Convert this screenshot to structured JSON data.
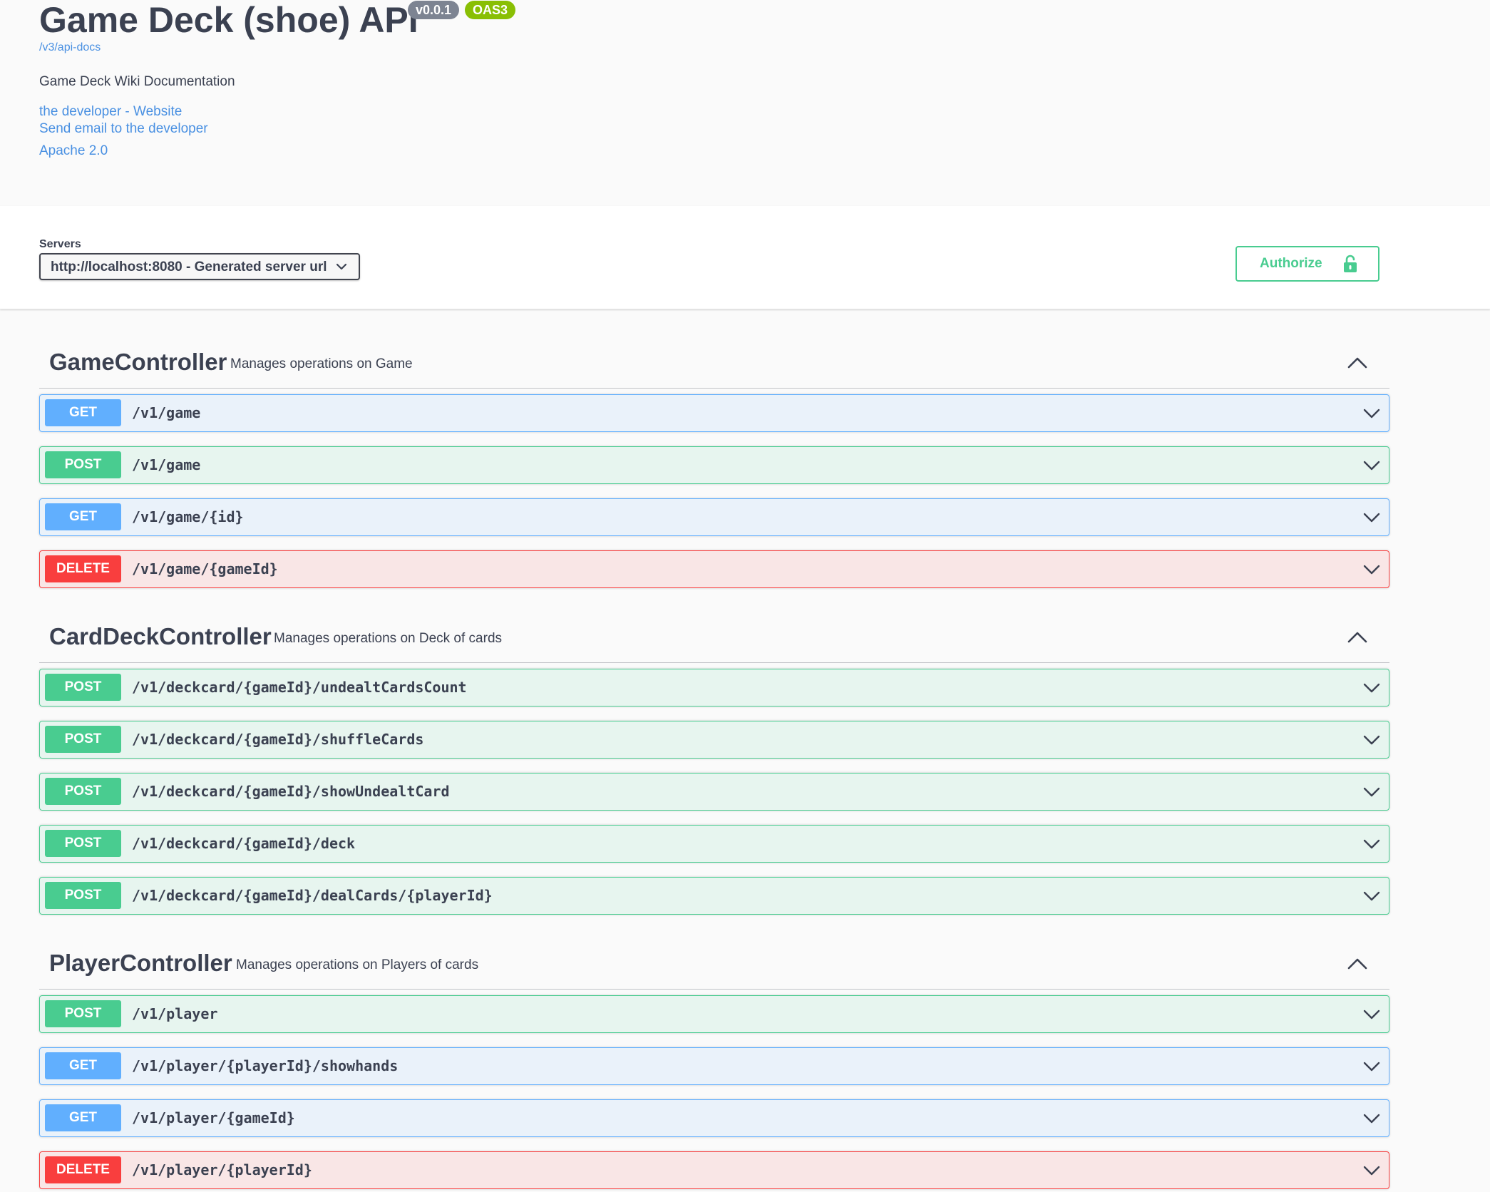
{
  "info": {
    "title": "Game Deck (shoe) API",
    "version": "v0.0.1",
    "oas": "OAS3",
    "spec_link": "/v3/api-docs",
    "description": "Game Deck Wiki Documentation",
    "website_link": "the developer - Website",
    "email_link": "Send email to the developer",
    "license_link": "Apache 2.0"
  },
  "servers": {
    "label": "Servers",
    "selected": "http://localhost:8080 - Generated server url"
  },
  "authorize": {
    "label": "Authorize"
  },
  "tags": [
    {
      "name": "GameController",
      "description": "Manages operations on Game",
      "operations": [
        {
          "method": "GET",
          "path": "/v1/game"
        },
        {
          "method": "POST",
          "path": "/v1/game"
        },
        {
          "method": "GET",
          "path": "/v1/game/{id}"
        },
        {
          "method": "DELETE",
          "path": "/v1/game/{gameId}"
        }
      ]
    },
    {
      "name": "CardDeckController",
      "description": "Manages operations on Deck of cards",
      "operations": [
        {
          "method": "POST",
          "path": "/v1/deckcard/{gameId}/undealtCardsCount"
        },
        {
          "method": "POST",
          "path": "/v1/deckcard/{gameId}/shuffleCards"
        },
        {
          "method": "POST",
          "path": "/v1/deckcard/{gameId}/showUndealtCard"
        },
        {
          "method": "POST",
          "path": "/v1/deckcard/{gameId}/deck"
        },
        {
          "method": "POST",
          "path": "/v1/deckcard/{gameId}/dealCards/{playerId}"
        }
      ]
    },
    {
      "name": "PlayerController",
      "description": "Manages operations on Players of cards",
      "operations": [
        {
          "method": "POST",
          "path": "/v1/player"
        },
        {
          "method": "GET",
          "path": "/v1/player/{playerId}/showhands"
        },
        {
          "method": "GET",
          "path": "/v1/player/{gameId}"
        },
        {
          "method": "DELETE",
          "path": "/v1/player/{playerId}"
        }
      ]
    }
  ],
  "colors": {
    "get": "#61affe",
    "post": "#49cc90",
    "delete": "#f93e3e",
    "link": "#4990e2",
    "text": "#3b4151"
  },
  "icons": {
    "authorize": "unlocked-padlock-icon",
    "server_select": "chevron-down-icon",
    "tag_toggle": "chevron-up-icon",
    "operation_toggle": "chevron-down-icon"
  }
}
